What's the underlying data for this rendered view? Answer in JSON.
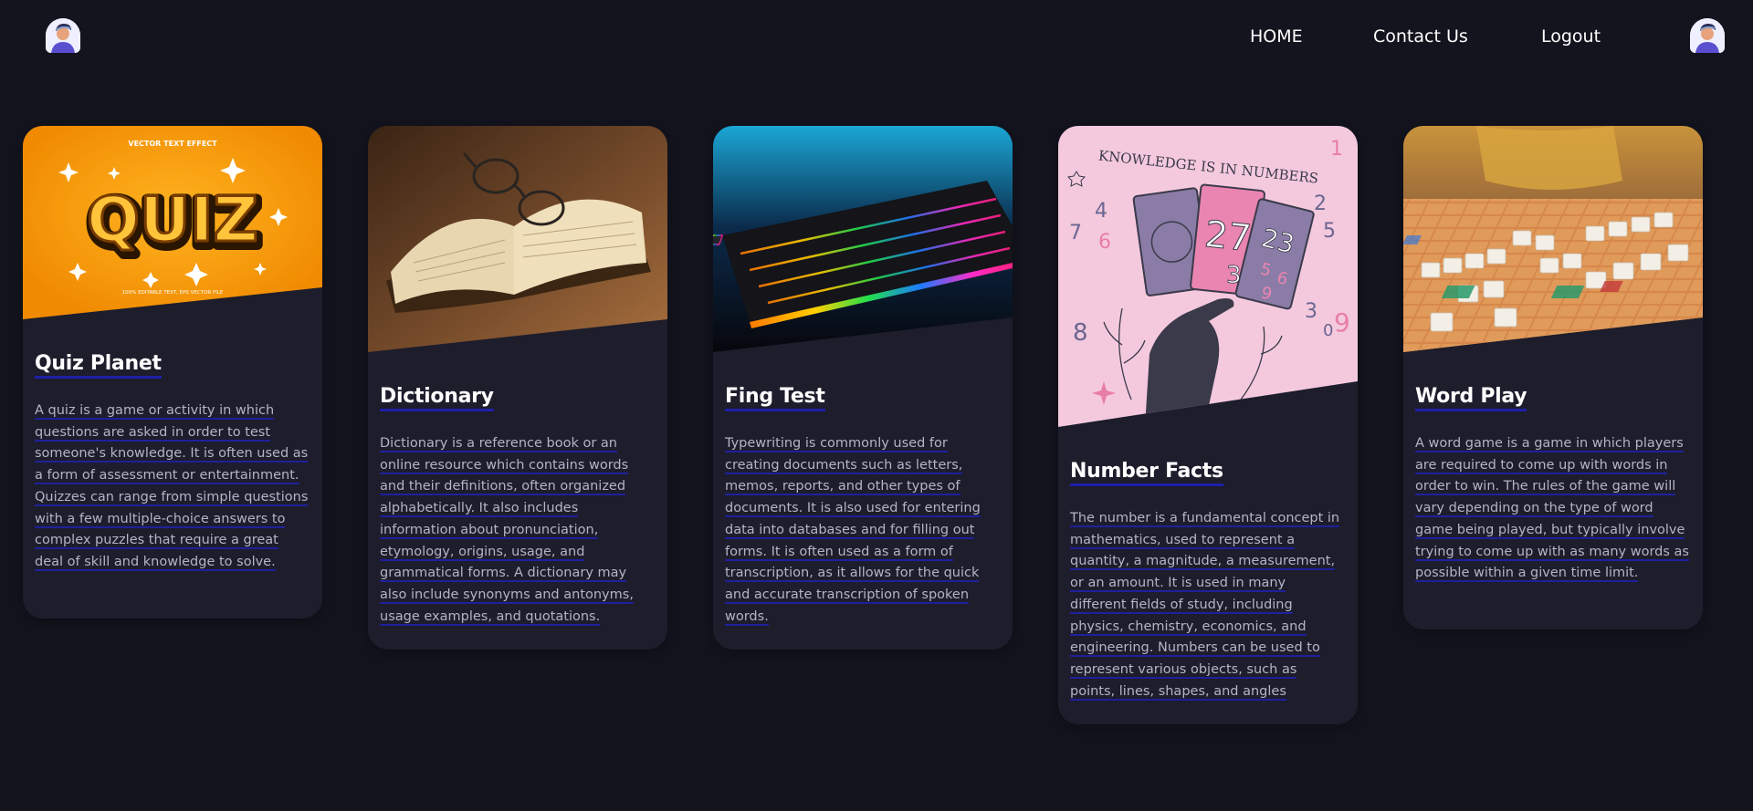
{
  "nav": {
    "home": "HOME",
    "contact": "Contact Us",
    "logout": "Logout"
  },
  "cards": [
    {
      "title": "Quiz Planet",
      "text": "A quiz is a game or activity in which questions are asked in order to test someone's knowledge. It is often used as a form of assessment or entertainment. Quizzes can range from simple questions with a few multiple-choice answers to complex puzzles that require a great deal of skill and knowledge to solve.",
      "image": {
        "caption_top": "VECTOR TEXT EFFECT",
        "word": "QUIZ",
        "caption_bottom": "100% EDITABLE TEXT, EPS VECTOR FILE"
      }
    },
    {
      "title": "Dictionary",
      "text": "Dictionary is a reference book or an online resource which contains words and their definitions, often organized alphabetically. It also includes information about pronunciation, etymology, origins, usage, and grammatical forms. A dictionary may also include synonyms and antonyms, usage examples, and quotations."
    },
    {
      "title": "Fing Test",
      "text": "Typewriting is commonly used for creating documents such as letters, memos, reports, and other types of documents. It is also used for entering data into databases and for filling out forms. It is often used as a form of transcription, as it allows for the quick and accurate transcription of spoken words."
    },
    {
      "title": "Number Facts",
      "text": "The number is a fundamental concept in mathematics, used to represent a quantity, a magnitude, a measurement, or an amount. It is used in many different fields of study, including physics, chemistry, economics, and engineering. Numbers can be used to represent various objects, such as points, lines, shapes, and angles",
      "image": {
        "heading": "KNOWLEDGE IS IN NUMBERS",
        "digits": [
          "1",
          "2",
          "3",
          "4",
          "5",
          "6",
          "7",
          "8",
          "9",
          "0"
        ],
        "card_numbers": [
          "27",
          "23",
          "3",
          "5",
          "6",
          "9"
        ]
      }
    },
    {
      "title": "Word Play",
      "text": "A word game is a game in which players are required to come up with words in order to win. The rules of the game will vary depending on the type of word game being played, but typically involve trying to come up with as many words as possible within a given time limit."
    }
  ],
  "colors": {
    "background": "#14141f",
    "card": "#1d1d2c",
    "underline": "#1f1fa8",
    "body_text": "#b4b4c6"
  },
  "icons": [
    "user-avatar-icon"
  ]
}
